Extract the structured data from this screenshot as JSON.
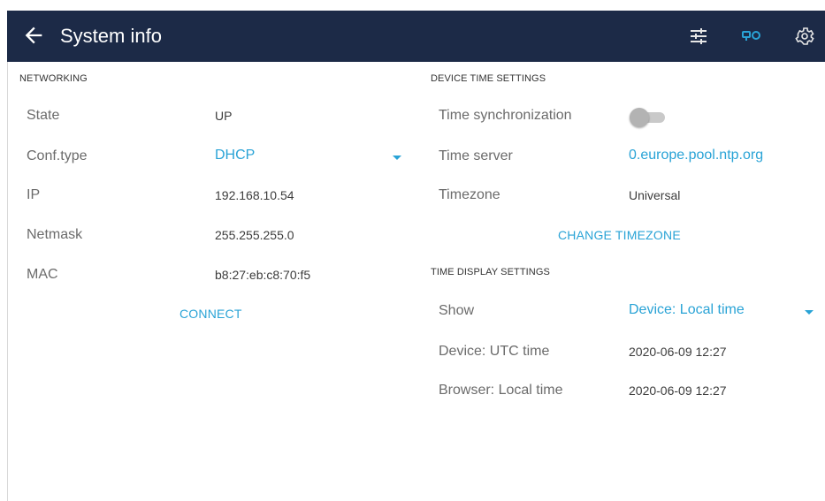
{
  "header": {
    "title": "System info",
    "back_icon": "arrow-left-icon",
    "icons": [
      "sliders-icon",
      "network-devices-icon",
      "gear-icon"
    ],
    "accent": "#29a3d6",
    "bar_color": "#1c2a47"
  },
  "networking": {
    "section_title": "NETWORKING",
    "state_label": "State",
    "state_value": "UP",
    "conf_type_label": "Conf.type",
    "conf_type_value": "DHCP",
    "ip_label": "IP",
    "ip_value": "192.168.10.54",
    "netmask_label": "Netmask",
    "netmask_value": "255.255.255.0",
    "mac_label": "MAC",
    "mac_value": "b8:27:eb:c8:70:f5",
    "connect_label": "CONNECT"
  },
  "device_time": {
    "section_title": "DEVICE TIME SETTINGS",
    "sync_label": "Time synchronization",
    "sync_enabled": false,
    "server_label": "Time server",
    "server_value": "0.europe.pool.ntp.org",
    "timezone_label": "Timezone",
    "timezone_value": "Universal",
    "change_timezone_label": "CHANGE TIMEZONE"
  },
  "time_display": {
    "section_title": "TIME DISPLAY SETTINGS",
    "show_label": "Show",
    "show_value": "Device: Local time",
    "utc_label": "Device: UTC time",
    "utc_value": "2020-06-09 12:27",
    "browser_label": "Browser: Local time",
    "browser_value": "2020-06-09 12:27"
  }
}
